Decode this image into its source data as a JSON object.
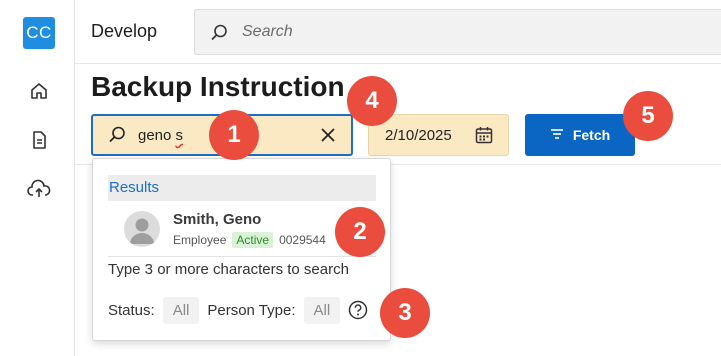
{
  "sidebar": {
    "logo_text": "CC",
    "icons": [
      "home-icon",
      "document-icon",
      "cloud-upload-icon"
    ]
  },
  "header": {
    "title": "Develop",
    "search_placeholder": "Search"
  },
  "page": {
    "title": "Backup Instruction"
  },
  "person_search": {
    "value_plain": "geno ",
    "value_misspelled": "s",
    "icons": [
      "search-icon",
      "clear-icon"
    ]
  },
  "date_field": {
    "value": "2/10/2025",
    "icon": "calendar-icon"
  },
  "fetch_button": {
    "label": "Fetch",
    "icon": "filter-lines-icon"
  },
  "dropdown": {
    "results_label": "Results",
    "result": {
      "name": "Smith, Geno",
      "type": "Employee",
      "status": "Active",
      "id": "0029544"
    },
    "hint": "Type 3 or more characters to search",
    "status_label": "Status:",
    "status_value": "All",
    "person_type_label": "Person Type:",
    "person_type_value": "All"
  },
  "markers": [
    "1",
    "2",
    "3",
    "4",
    "5"
  ],
  "colors": {
    "accent": "#0a66c2",
    "logo": "#1f8de0",
    "field_background": "#fbe9c4",
    "marker": "#ea4d3e",
    "active_badge": "#d9f2d6"
  }
}
